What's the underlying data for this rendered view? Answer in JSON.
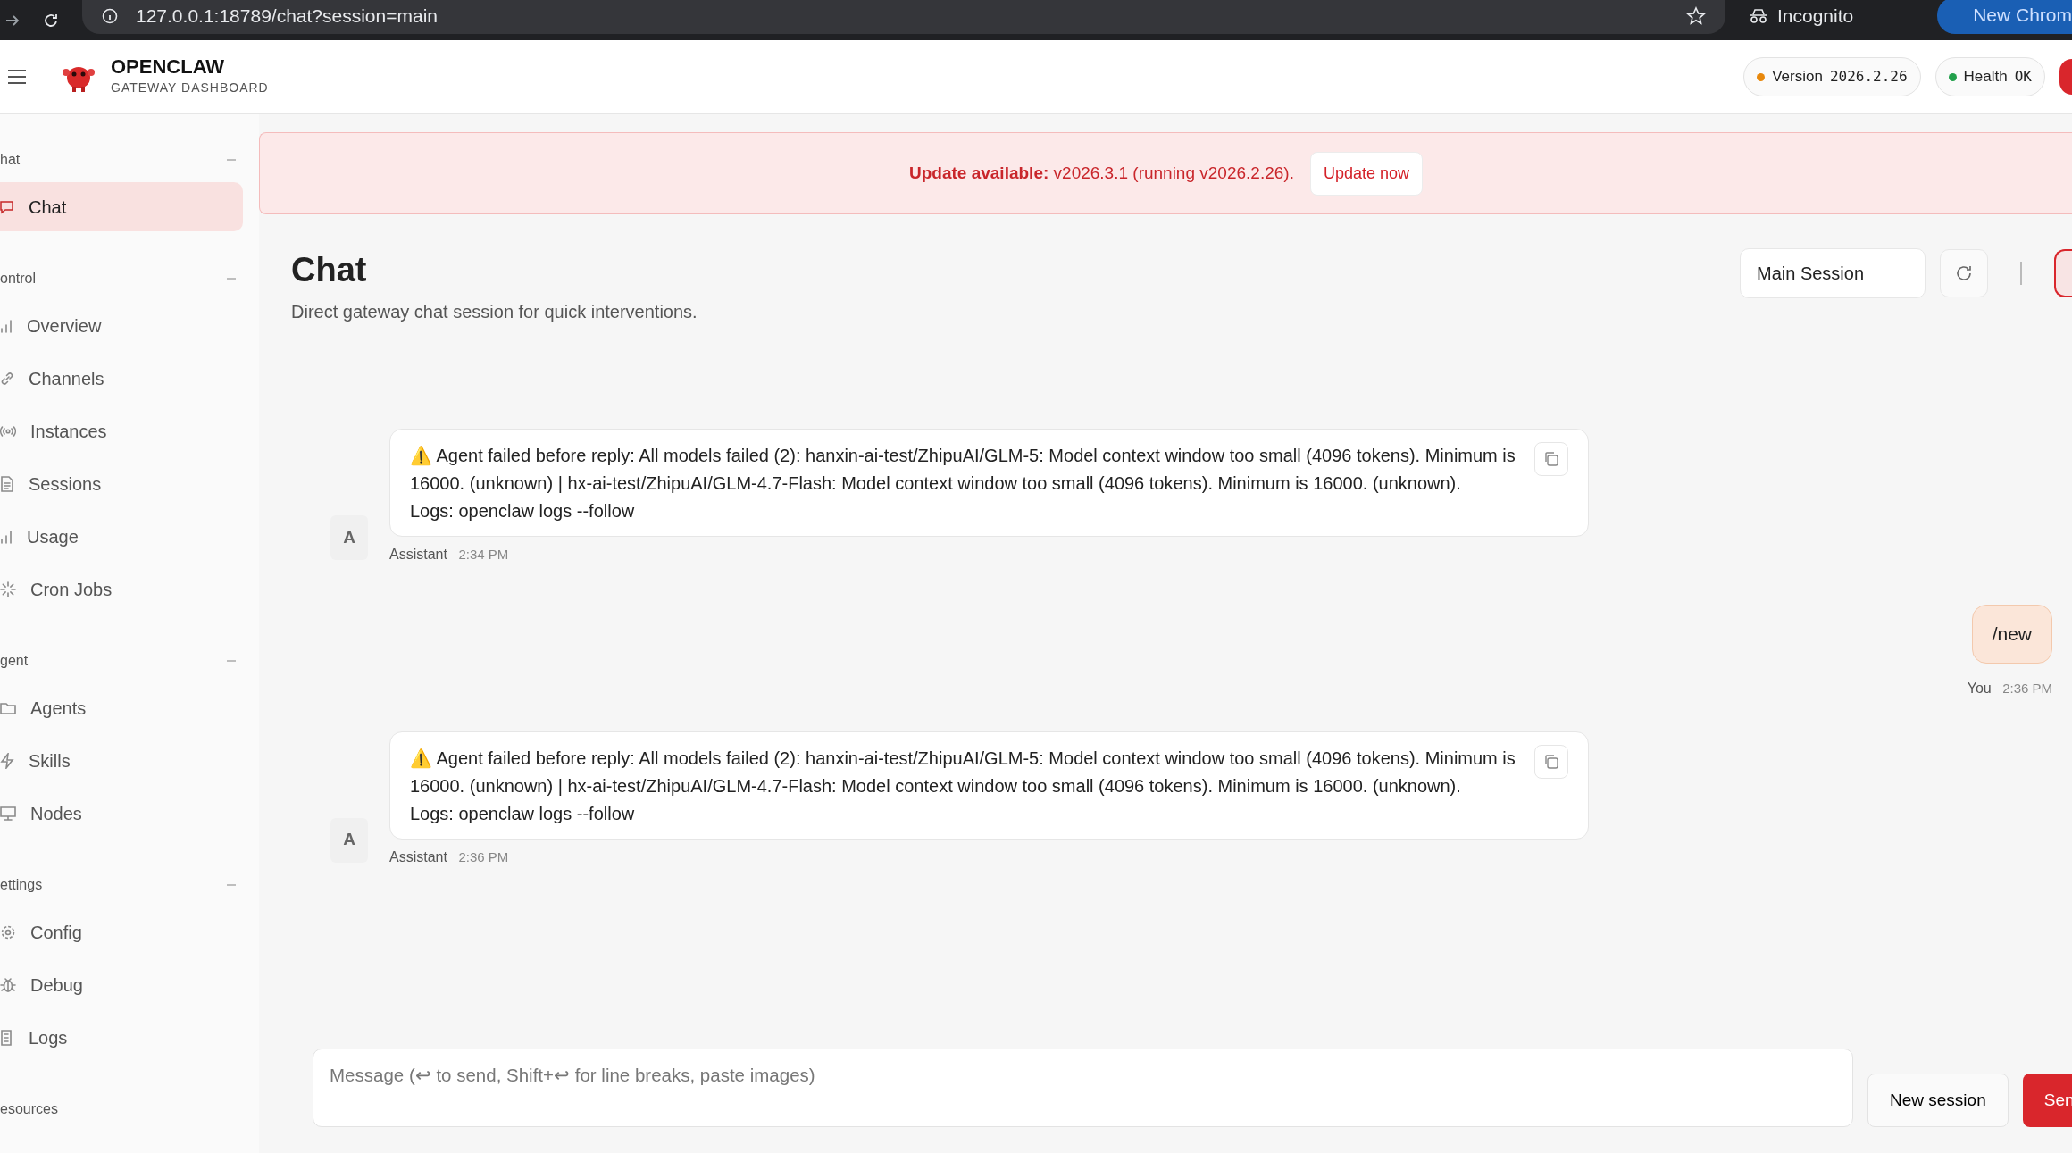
{
  "browser": {
    "url": "127.0.0.1:18789/chat?session=main",
    "profile": "Incognito",
    "tab_text": "New Chrom"
  },
  "header": {
    "brand": "OPENCLAW",
    "subtitle": "GATEWAY DASHBOARD",
    "status_pills": [
      {
        "label": "Version",
        "value": "2026.2.26",
        "color": "#e8880c"
      },
      {
        "label": "Health",
        "value": "OK",
        "color": "#22a04b"
      }
    ]
  },
  "nav": [
    {
      "label": "hat",
      "items": [
        {
          "label": "Chat",
          "selected": true
        }
      ]
    },
    {
      "label": "ontrol",
      "items": [
        {
          "label": "Overview",
          "selected": false
        },
        {
          "label": "Channels",
          "selected": false
        },
        {
          "label": "Instances",
          "selected": false
        },
        {
          "label": "Sessions",
          "selected": false
        },
        {
          "label": "Usage",
          "selected": false
        },
        {
          "label": "Cron Jobs",
          "selected": false
        }
      ]
    },
    {
      "label": "gent",
      "items": [
        {
          "label": "Agents",
          "selected": false
        },
        {
          "label": "Skills",
          "selected": false
        },
        {
          "label": "Nodes",
          "selected": false
        }
      ]
    },
    {
      "label": "ettings",
      "items": [
        {
          "label": "Config",
          "selected": false
        },
        {
          "label": "Debug",
          "selected": false
        },
        {
          "label": "Logs",
          "selected": false
        }
      ]
    },
    {
      "label": "esources"
    }
  ],
  "banner": {
    "text": "**Update available:** v2026.3.1 (running v2026.2.26).",
    "button": "Update now"
  },
  "page": {
    "title": "Chat",
    "subtitle": "Direct gateway chat session for quick interventions.",
    "session": "Main Session"
  },
  "messages": [
    {
      "kind": "assistant",
      "avatar": "A",
      "text": "⚠️ Agent failed before reply: All models failed (2): hanxin-ai-test/ZhipuAI/GLM-5: Model context window too small (4096 tokens). Minimum is 16000. (unknown) | hx-ai-test/ZhipuAI/GLM-4.7-Flash: Model context window too small (4096 tokens). Minimum is 16000. (unknown).\nLogs: openclaw logs --follow",
      "sender": "Assistant",
      "time": "2:34 PM"
    },
    {
      "kind": "user",
      "text": "/new",
      "sender": "You",
      "time": "2:36 PM"
    },
    {
      "kind": "assistant",
      "avatar": "A",
      "text": "⚠️ Agent failed before reply: All models failed (2): hanxin-ai-test/ZhipuAI/GLM-5: Model context window too small (4096 tokens). Minimum is 16000. (unknown) | hx-ai-test/ZhipuAI/GLM-4.7-Flash: Model context window too small (4096 tokens). Minimum is 16000. (unknown).\nLogs: openclaw logs --follow",
      "sender": "Assistant",
      "time": "2:36 PM"
    }
  ],
  "composer": {
    "placeholder": "Message (↩ to send, Shift+↩ for line breaks, paste images)",
    "new_session": "New session",
    "send": "Sen"
  }
}
